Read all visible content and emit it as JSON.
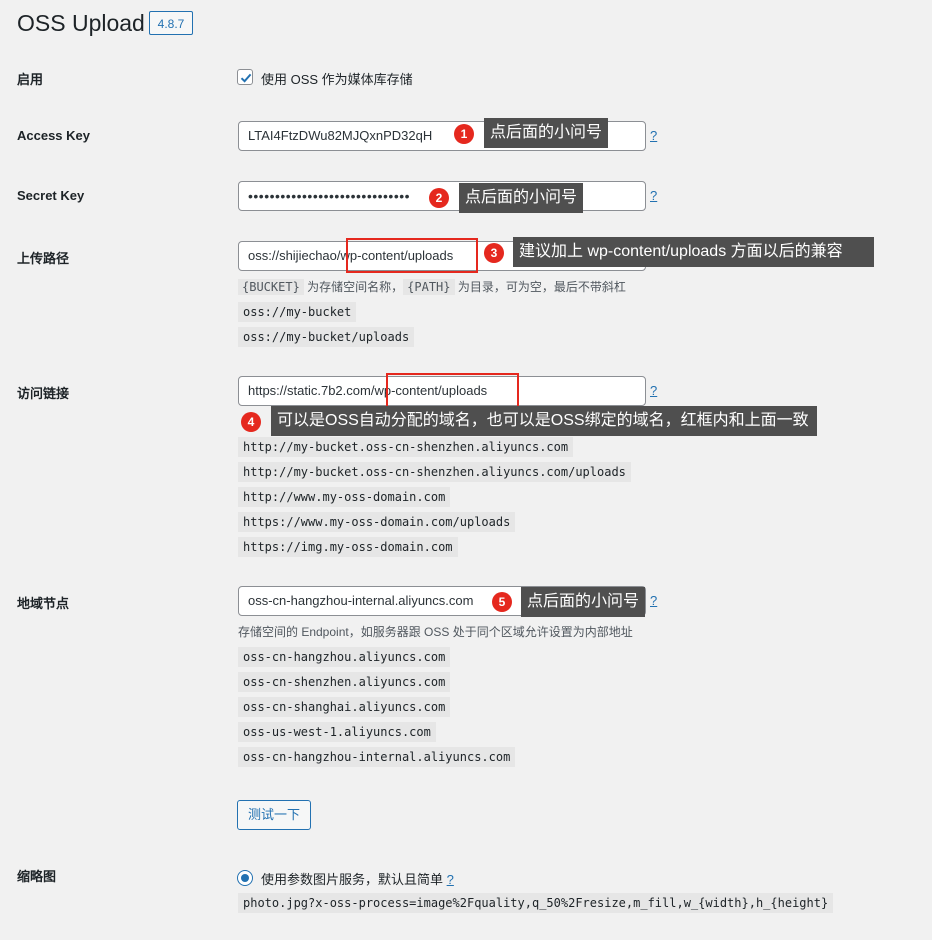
{
  "page": {
    "title": "OSS Upload",
    "version": "4.8.7"
  },
  "enable": {
    "label": "启用",
    "checkbox_label": "使用 OSS 作为媒体库存储",
    "checked": true
  },
  "access_key": {
    "label": "Access Key",
    "value": "LTAI4FtzDWu82MJQxnPD32qH",
    "help": "?"
  },
  "secret_key": {
    "label": "Secret Key",
    "value": "••••••••••••••••••••••••••••••",
    "help": "?"
  },
  "upload_path": {
    "label": "上传路径",
    "value": "oss://shijiechao/wp-content/uploads",
    "desc_code1": "{BUCKET}",
    "desc_mid": " 为存储空间名称，",
    "desc_code2": "{PATH}",
    "desc_end": " 为目录，可为空，最后不带斜杠",
    "examples": [
      "oss://my-bucket",
      "oss://my-bucket/uploads"
    ]
  },
  "access_url": {
    "label": "访问链接",
    "value": "https://static.7b2.com/wp-content/uploads",
    "help": "?",
    "examples": [
      "http://my-bucket.oss-cn-shenzhen.aliyuncs.com",
      "http://my-bucket.oss-cn-shenzhen.aliyuncs.com/uploads",
      "http://www.my-oss-domain.com",
      "https://www.my-oss-domain.com/uploads",
      "https://img.my-oss-domain.com"
    ]
  },
  "endpoint": {
    "label": "地域节点",
    "value": "oss-cn-hangzhou-internal.aliyuncs.com",
    "help": "?",
    "desc": "存储空间的 Endpoint，如服务器跟 OSS 处于同个区域允许设置为内部地址",
    "examples": [
      "oss-cn-hangzhou.aliyuncs.com",
      "oss-cn-shenzhen.aliyuncs.com",
      "oss-cn-shanghai.aliyuncs.com",
      "oss-us-west-1.aliyuncs.com",
      "oss-cn-hangzhou-internal.aliyuncs.com"
    ],
    "test_button": "测试一下"
  },
  "thumbnail": {
    "label": "缩略图",
    "radio_label": "使用参数图片服务，默认且简单",
    "help": "?",
    "example": "photo.jpg?x-oss-process=image%2Fquality,q_50%2Fresize,m_fill,w_{width},h_{height}"
  },
  "annotations": [
    {
      "num": "1",
      "text": "点后面的小问号"
    },
    {
      "num": "2",
      "text": "点后面的小问号"
    },
    {
      "num": "3",
      "text": "建议加上 wp-content/uploads 方面以后的兼容"
    },
    {
      "num": "4",
      "text": "可以是OSS自动分配的域名，也可以是OSS绑定的域名，红框内和上面一致"
    },
    {
      "num": "5",
      "text": "点后面的小问号"
    }
  ],
  "colors": {
    "accent": "#2271b1",
    "annotation_red": "#e5281e",
    "callout_bg": "#4f4f4f",
    "page_bg": "#f1f1f1"
  }
}
